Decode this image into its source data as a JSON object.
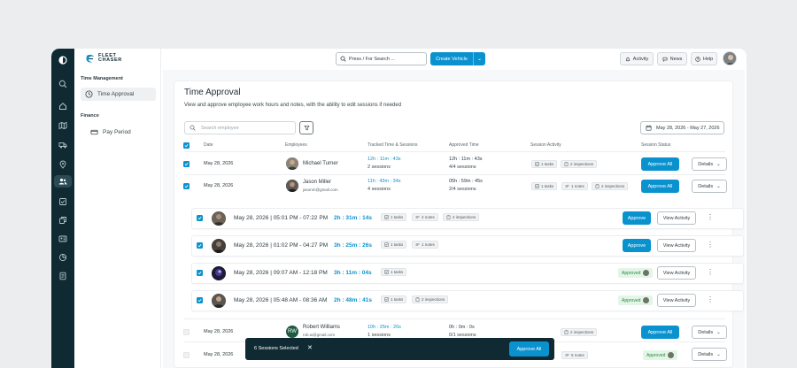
{
  "brand": {
    "logo_text": "FLEET\nCHASER"
  },
  "topbar": {
    "search_placeholder": "Press / For Search ...",
    "create_label": "Create Vehicle",
    "activity_label": "Activity",
    "news_label": "News",
    "help_label": "Help"
  },
  "sidebar": {
    "section1": "Time Management",
    "item_time_approval": "Time Approval",
    "section2": "Finance",
    "item_pay_period": "Pay Period"
  },
  "page": {
    "title": "Time Approval",
    "subtitle": "View and approve employee work hours and notes, with the ability to edit sessions if needed",
    "search_placeholder": "Search employee",
    "date_range": "May 28, 2026 - May 27, 2026"
  },
  "table": {
    "headers": [
      "Date",
      "Employees",
      "Tracked Time & Sessions",
      "Approved Time",
      "Session Activity",
      "Session Status"
    ],
    "rows": [
      {
        "date": "May 28, 2026",
        "name": "Michael Turner",
        "email": "",
        "tracked": "12h : 11m : 43s",
        "sessions": "2 sessions",
        "approved": "12h : 11m : 43s",
        "approved_sessions": "4/4 sessions",
        "tasks": "1 tasks",
        "notes": "",
        "inspections": "2 inspections",
        "action": "Approve All",
        "details": "Details"
      },
      {
        "date": "May 28, 2026",
        "name": "Jason Miller",
        "email": "jasonm@gmail.com",
        "tracked": "11h : 43m : 34s",
        "sessions": "4 sessions",
        "approved": "05h : 59m : 45s",
        "approved_sessions": "2/4 sessions",
        "tasks": "1 tasks",
        "notes": "1 notes",
        "inspections": "2 inspections",
        "action": "Approve All",
        "details": "Details"
      },
      {
        "date": "May 28, 2026",
        "name": "Robert Williams",
        "initials": "RW",
        "email": "rob.w@gmail.com",
        "tracked": "10h : 25m : 20s",
        "sessions": "1 sessions",
        "approved": "0h : 0m : 0s",
        "approved_sessions": "0/1 sessions",
        "inspections": "2 inspections",
        "action": "Approve All",
        "details": "Details"
      },
      {
        "date": "May 28, 2026",
        "notes": "5 notes",
        "status": "Approved",
        "details": "Details"
      }
    ]
  },
  "sessions": [
    {
      "time": "May 28, 2026 | 05:01 PM - 07:22 PM",
      "duration": "2h : 31m : 14s",
      "tasks": "1 tasks",
      "notes": "2 notes",
      "inspections": "2 inspections",
      "action": "Approve",
      "view": "View Activity"
    },
    {
      "time": "May 28, 2026 | 01:02 PM - 04:27 PM",
      "duration": "3h : 25m : 26s",
      "tasks": "1 tasks",
      "notes": "1 notes",
      "action": "Approve",
      "view": "View Activity"
    },
    {
      "time": "May 28, 2026 | 09:07 AM - 12:18 PM",
      "duration": "3h : 11m : 04s",
      "tasks": "1 tasks",
      "status": "Approved",
      "view": "View Activity"
    },
    {
      "time": "May 28, 2026 | 05:48 AM - 08:36 AM",
      "duration": "2h : 48m : 41s",
      "tasks": "1 tasks",
      "inspections": "2 inspections",
      "status": "Approved",
      "view": "View Activity"
    }
  ],
  "toast": {
    "text": "6 Sessions Selected",
    "button": "Approve All"
  },
  "colors": {
    "accent": "#0a92cf",
    "rail": "#0f2a33",
    "approved_bg": "#e2f5e7",
    "approved_fg": "#2f8a43"
  }
}
